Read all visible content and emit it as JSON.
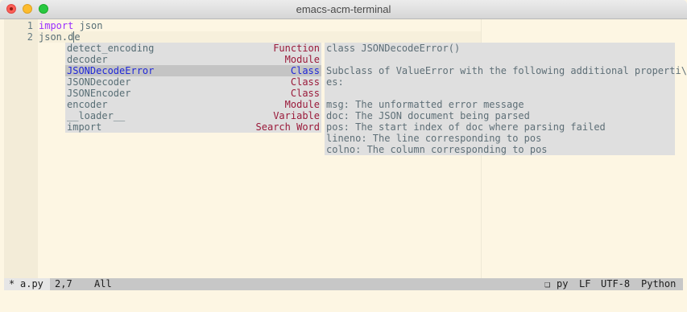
{
  "window": {
    "title": "emacs-acm-terminal"
  },
  "editor": {
    "line_numbers": [
      "1",
      "2"
    ],
    "lines": [
      {
        "keyword": "import",
        "rest": " json"
      },
      {
        "before_cursor": "json.d",
        "after_cursor": "e"
      }
    ]
  },
  "completion": {
    "items": [
      {
        "candidate": "detect_encoding",
        "kind": "Function",
        "selected": false
      },
      {
        "candidate": "decoder",
        "kind": "Module",
        "selected": false
      },
      {
        "candidate": "JSONDecodeError",
        "kind": "Class",
        "selected": true
      },
      {
        "candidate": "JSONDecoder",
        "kind": "Class",
        "selected": false
      },
      {
        "candidate": "JSONEncoder",
        "kind": "Class",
        "selected": false
      },
      {
        "candidate": "encoder",
        "kind": "Module",
        "selected": false
      },
      {
        "candidate": "__loader__",
        "kind": "Variable",
        "selected": false
      },
      {
        "candidate": "import",
        "kind": "Search Word",
        "selected": false
      }
    ]
  },
  "doc": {
    "lines": [
      "class JSONDecodeError()",
      "",
      "Subclass of ValueError with the following additional properti\\",
      "es:",
      "",
      "msg: The unformatted error message",
      "doc: The JSON document being parsed",
      "pos: The start index of doc where parsing failed",
      "lineno: The line corresponding to pos",
      "colno: The column corresponding to pos"
    ]
  },
  "modeline": {
    "modified": "*",
    "buffer": "a.py",
    "position": "2,7",
    "scroll": "All",
    "mode_icon": "❏",
    "file_ext": "py",
    "eol": "LF",
    "encoding": "UTF-8",
    "major_mode": "Python"
  }
}
